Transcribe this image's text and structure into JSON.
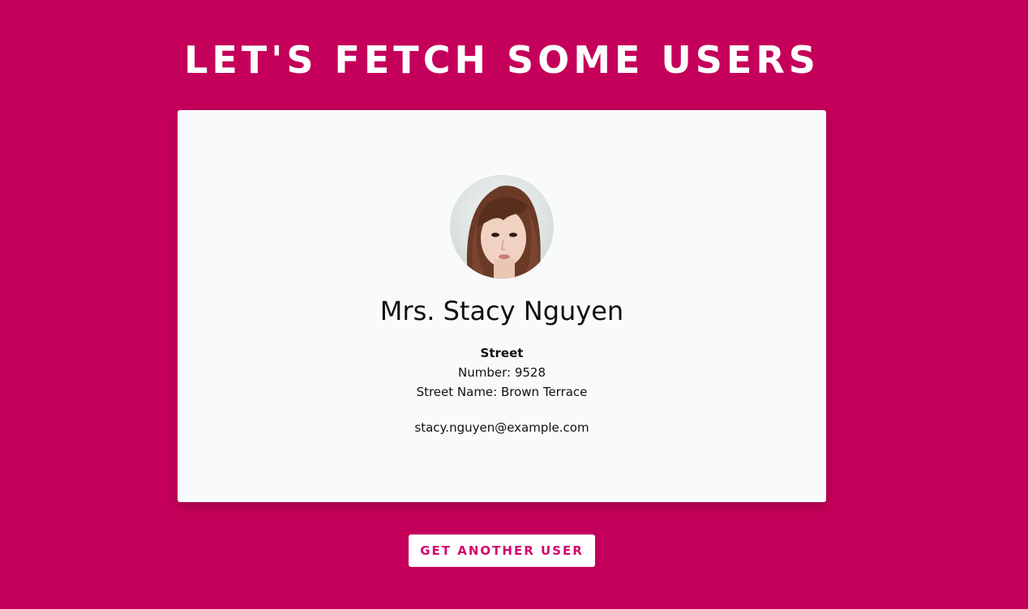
{
  "page": {
    "title": "LET'S FETCH SOME USERS"
  },
  "user": {
    "name": "Mrs. Stacy Nguyen",
    "street_heading": "Street",
    "number_line": "Number: 9528",
    "street_name_line": "Street Name: Brown Terrace",
    "email": "stacy.nguyen@example.com"
  },
  "actions": {
    "get_user_label": "GET ANOTHER USER"
  },
  "colors": {
    "background": "#c5005a",
    "card": "#f9fafc",
    "button_text": "#d6006d"
  },
  "icons": {
    "avatar": "user-photo-avatar"
  }
}
